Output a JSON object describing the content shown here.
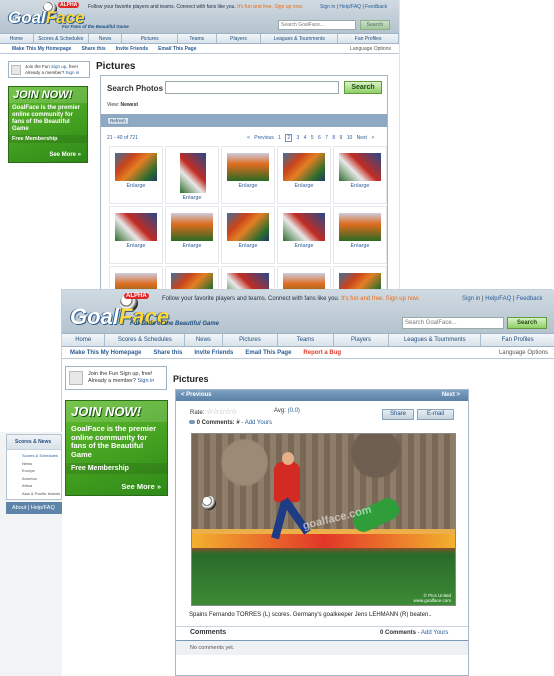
{
  "site": {
    "logo_main": "Goal",
    "logo_accent": "Face",
    "alpha": "ALPHA",
    "tagline": "For Fans of the Beautiful Game",
    "promo_pre": "Follow your favorite players and teams. Connect with fans like you.",
    "promo_highlight": "It's fun and free. Sign up now."
  },
  "toplinks": {
    "signin": "Sign in",
    "help": "Help/FAQ",
    "feedback": "Feedback"
  },
  "search": {
    "placeholder": "Search GoalFace...",
    "button": "Search"
  },
  "nav": [
    "Home",
    "Scores & Schedules",
    "News",
    "Pictures",
    "Teams",
    "Players",
    "Leagues & Tournments",
    "Fan Profiles"
  ],
  "nav_small": [
    "Scores & Schedules",
    "News",
    "Pictures",
    "Teams",
    "Players",
    "Leagues & Tournments",
    "Fan Profiles"
  ],
  "subnav": {
    "homepage": "Make This My Homepage",
    "share": "Share this",
    "invite": "Invite Friends",
    "email": "Email This Page",
    "bug": "Report a Bug",
    "language": "Language Options"
  },
  "login": {
    "line1": "Join the Fun Sign up, free!",
    "line2_pre": "Already a member?",
    "signin": "Sign in"
  },
  "login_small": {
    "line1_pre": "Join the Fun",
    "signup": "Sign up",
    "line1_post": "free!",
    "line2_pre": "Already a member?",
    "signin": "Sign in"
  },
  "join": {
    "title": "JOIN NOW!",
    "body": "GoalFace is the premier online community for fans of the Beautiful Game",
    "membership": "Free Membership",
    "more": "See More »"
  },
  "gallery": {
    "title": "Pictures",
    "search_label": "Search Photos",
    "search_button": "Search",
    "view_label": "View:",
    "view_value": "Newest",
    "refresh": "Refresh",
    "range": "21 - 40 of 721",
    "prev": "< Previous",
    "pages": [
      "1",
      "2",
      "3",
      "4",
      "5",
      "6",
      "7",
      "8",
      "9",
      "10"
    ],
    "next": "Next >",
    "enlarge": "Enlarge"
  },
  "detail": {
    "title": "Pictures",
    "prev": "< Previous",
    "next": "Next >",
    "rate_label": "Rate:",
    "avg_label": "Avg:",
    "avg_value": "(0.0)",
    "comments_count": "0 Comments: #",
    "add_yours": "- Add Yours",
    "share": "Share",
    "email": "E-mail",
    "caption": "Spains Fernando TORRES (L) scores. Germany's goalkeeper Jens LEHMANN (R) beaten..",
    "credit": "© Pics United",
    "credit_url": "www.goalface.com",
    "watermark": "goalface.com",
    "comments_title": "Comments",
    "comments_right": "0 Comments",
    "comments_add": "- Add Yours",
    "no_comments": "No comments yet."
  },
  "sidebar": {
    "heading": "Scores & News",
    "items": [
      "Scores & Schedules",
      "News",
      "Europe",
      "America",
      "Africa",
      "Asia & Pacific Islands"
    ],
    "footer_about": "About",
    "footer_help": "Help/FAQ"
  },
  "colors": {
    "accent_green": "#4caf2a",
    "link_blue": "#2a5d9a",
    "header_blue": "#c3d0da",
    "promo_orange": "#f06b12"
  }
}
